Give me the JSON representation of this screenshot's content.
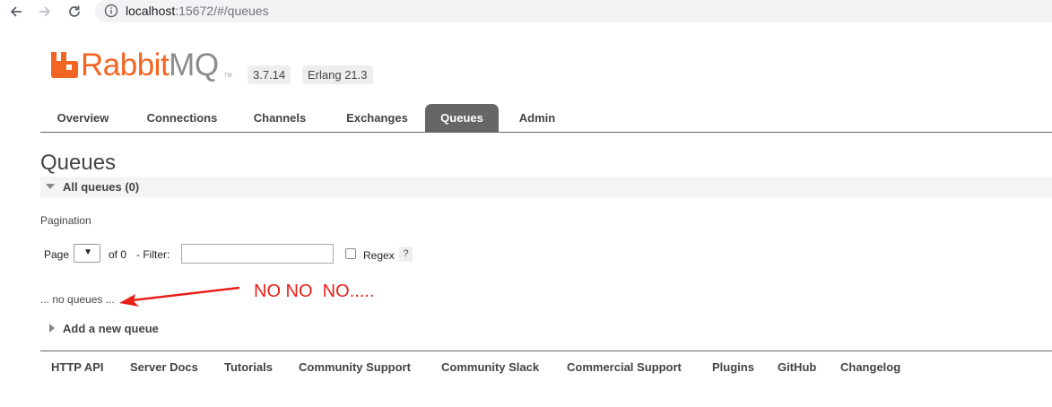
{
  "browser": {
    "url_host": "localhost",
    "url_rest": ":15672/#/queues"
  },
  "logo": {
    "rabbit": "Rabbit",
    "mq": "MQ",
    "tm": "TM"
  },
  "version": "3.7.14",
  "erlang": "Erlang 21.3",
  "tabs": [
    {
      "label": "Overview",
      "active": false
    },
    {
      "label": "Connections",
      "active": false
    },
    {
      "label": "Channels",
      "active": false
    },
    {
      "label": "Exchanges",
      "active": false
    },
    {
      "label": "Queues",
      "active": true
    },
    {
      "label": "Admin",
      "active": false
    }
  ],
  "main": {
    "title": "Queues",
    "section_label": "All queues (0)",
    "pagination_label": "Pagination",
    "page_label": "Page",
    "page_select_value": "",
    "of_label": "of 0",
    "filter_label": "- Filter:",
    "filter_value": "",
    "regex_label": "Regex",
    "regex_checked": false,
    "help_label": "?",
    "empty_message": "... no queues ...",
    "add_queue_label": "Add a new queue"
  },
  "annotation": {
    "text": "NO NO  NO.....",
    "color": "#e8201a"
  },
  "footer": {
    "links": [
      "HTTP API",
      "Server Docs",
      "Tutorials",
      "Community Support",
      "Community Slack",
      "Commercial Support",
      "Plugins",
      "GitHub",
      "Changelog"
    ]
  },
  "colors": {
    "brand_orange": "#f26522",
    "tab_active_bg": "#666666"
  }
}
